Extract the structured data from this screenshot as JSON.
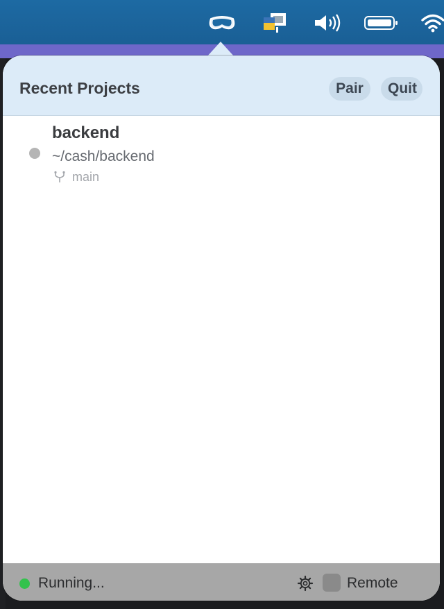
{
  "menubar": {
    "icons": [
      "vision-pro-icon",
      "app-status-icon",
      "speaker-icon",
      "battery-icon",
      "wifi-icon"
    ]
  },
  "popover": {
    "title": "Recent Projects",
    "pair_label": "Pair",
    "quit_label": "Quit"
  },
  "projects": [
    {
      "name": "backend",
      "path": "~/cash/backend",
      "branch": "main",
      "status_color": "#b5b5b5"
    }
  ],
  "footer": {
    "status_label": "Running...",
    "status_color": "#33c24d",
    "settings_icon": "gear-icon",
    "remote_label": "Remote",
    "remote_checked": false
  },
  "colors": {
    "menubar": "#1d6aa3",
    "header": "#dcebf8",
    "footer": "#a7a7a7"
  }
}
